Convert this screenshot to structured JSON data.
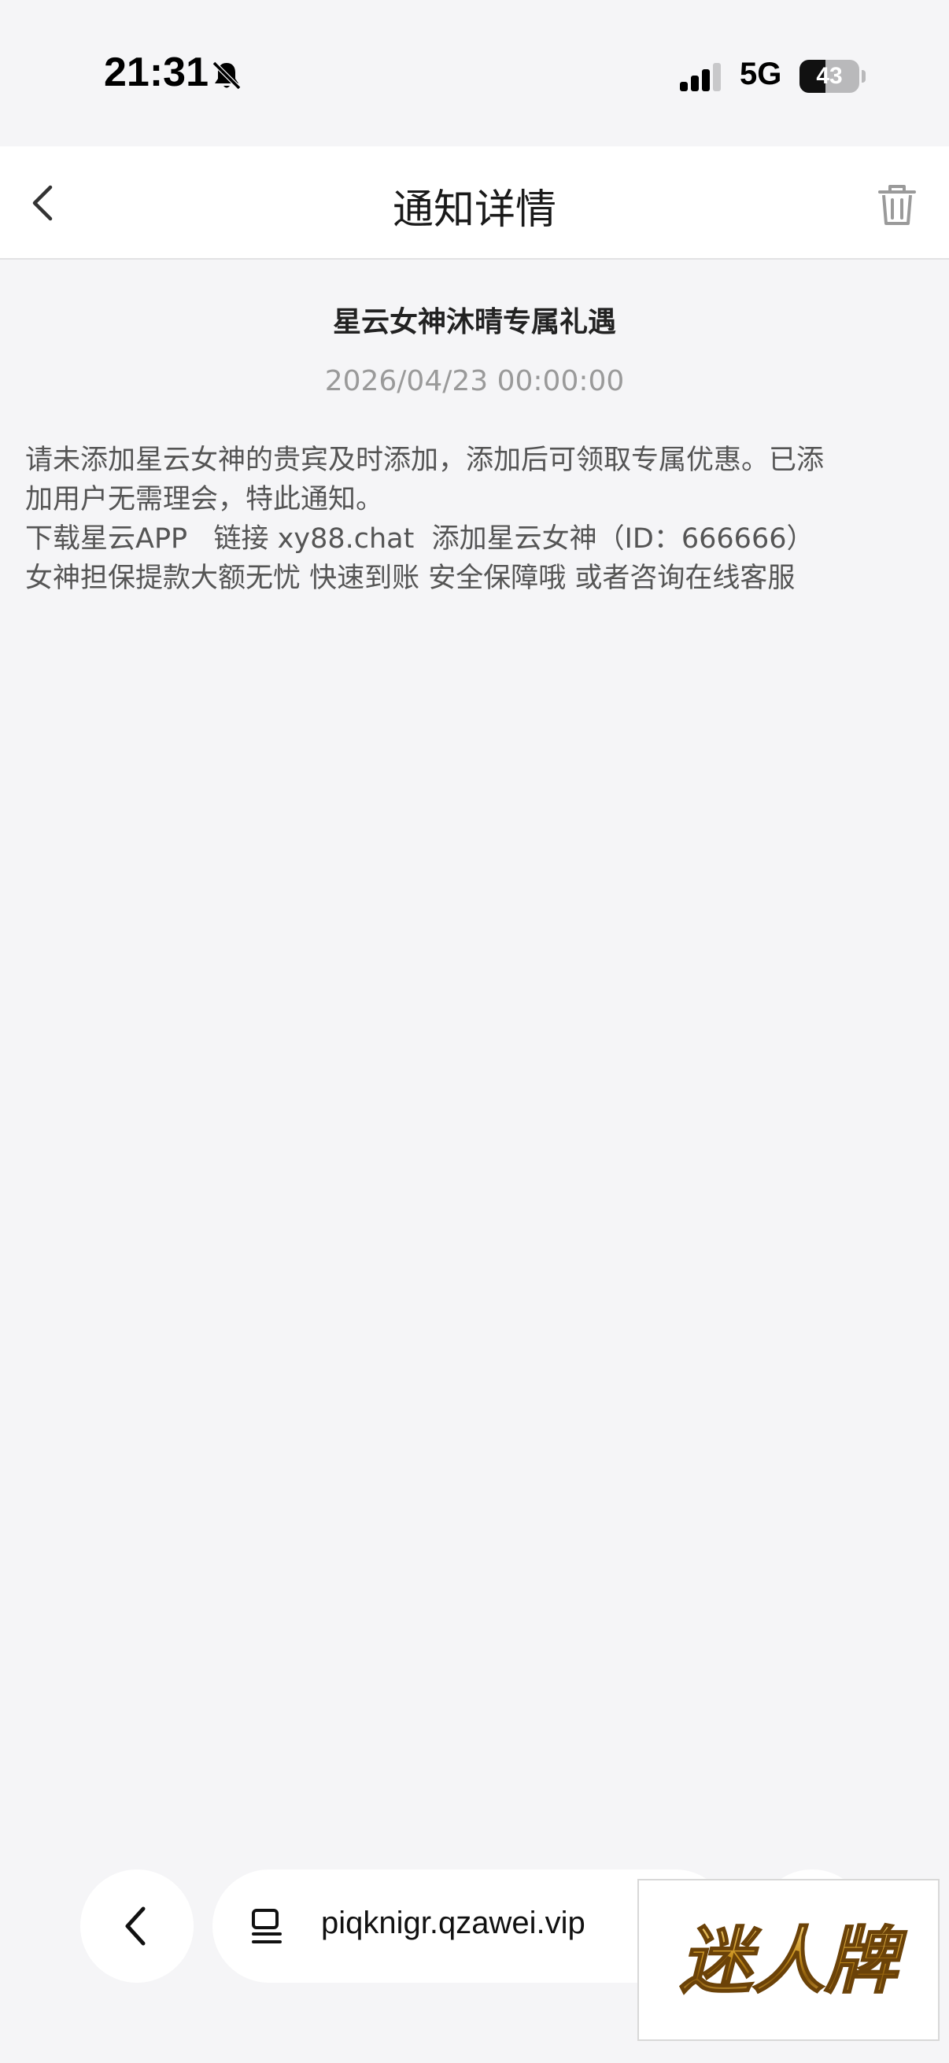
{
  "status_bar": {
    "time": "21:31",
    "network": "5G",
    "battery_level": "43",
    "battery_fraction": 0.43
  },
  "header": {
    "title": "通知详情",
    "back_icon": "chevron-left-icon",
    "delete_icon": "trash-icon"
  },
  "notice": {
    "title": "星云女神沐晴专属礼遇",
    "date": "2026/04/23 00:00:00",
    "body_lines": [
      "请未添加星云女神的贵宾及时添加，添加后可领取专属优惠。已添",
      "加用户无需理会，特此通知。",
      "下载星云APP   链接 xy88.chat  添加星云女神（ID：666666）",
      "女神担保提款大额无忧 快速到账 安全保障哦 或者咨询在线客服"
    ]
  },
  "browser": {
    "url": "piqknigr.qzawei.vip",
    "back_icon": "chevron-left-icon",
    "page_icon": "page-menu-icon"
  },
  "watermark": {
    "text": "迷人牌"
  },
  "colors": {
    "background": "#f5f5f7",
    "header_bg": "#ffffff",
    "date_text": "#9a9a9a",
    "body_text": "#555555",
    "watermark_gold": "#b8860b"
  }
}
